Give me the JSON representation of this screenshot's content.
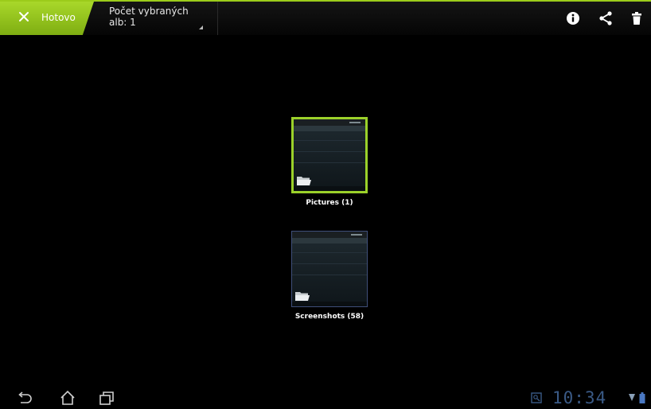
{
  "action_bar": {
    "done_label": "Hotovo",
    "selection_line1": "Počet vybraných",
    "selection_line2": "alb: 1",
    "icons": [
      "info-icon",
      "share-icon",
      "delete-icon"
    ]
  },
  "albums": [
    {
      "label": "Pictures (1)",
      "selected": true
    },
    {
      "label": "Screenshots (58)",
      "selected": false
    }
  ],
  "nav_bar": {
    "buttons": [
      "back-icon",
      "home-icon",
      "recent-apps-icon"
    ],
    "clock": "10:34",
    "status_icons": [
      "gallery-notification-icon",
      "wifi-signal-icon",
      "battery-icon"
    ]
  },
  "colors": {
    "accent": "#9ccc1b",
    "selected_border": "#9bd12a",
    "normal_border": "#3f4f7a",
    "clock": "#3a5a86"
  }
}
